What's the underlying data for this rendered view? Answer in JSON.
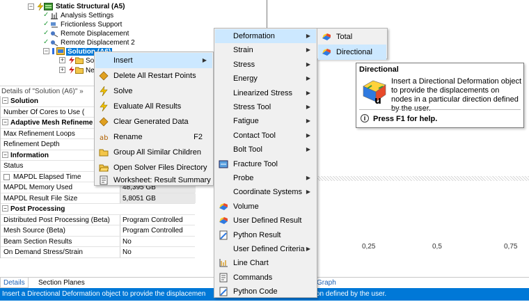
{
  "tree": {
    "items": [
      {
        "label": "Static Structural (A5)",
        "bold": true
      },
      {
        "label": "Analysis Settings"
      },
      {
        "label": "Frictionless Support"
      },
      {
        "label": "Remote Displacement"
      },
      {
        "label": "Remote Displacement 2"
      },
      {
        "label": "Solution (A6)",
        "selected": true
      },
      {
        "label": "So"
      },
      {
        "label": "Ne"
      }
    ]
  },
  "details": {
    "header": "Details of \"Solution (A6)\" »",
    "rows": [
      {
        "kind": "group",
        "label": "Solution"
      },
      {
        "label": "Number Of Cores to Use (",
        "value": ""
      },
      {
        "kind": "group",
        "label": "Adaptive Mesh Refineme"
      },
      {
        "label": "Max Refinement Loops",
        "value": ""
      },
      {
        "label": "Refinement Depth",
        "value": ""
      },
      {
        "kind": "group",
        "label": "Information"
      },
      {
        "label": "Status",
        "value": ""
      },
      {
        "label": "MAPDL Elapsed Time",
        "value": "",
        "checkbox": true
      },
      {
        "label": "MAPDL Memory Used",
        "value": "48,395 GB",
        "grey": true
      },
      {
        "label": "MAPDL Result File Size",
        "value": "5,8051 GB",
        "grey": true
      },
      {
        "kind": "group",
        "label": "Post Processing"
      },
      {
        "label": "Distributed Post Processing (Beta)",
        "value": "Program Controlled"
      },
      {
        "label": "Mesh Source (Beta)",
        "value": "Program Controlled"
      },
      {
        "label": "Beam Section Results",
        "value": "No"
      },
      {
        "label": "On Demand Stress/Strain",
        "value": "No"
      }
    ]
  },
  "graph_axis": [
    "0,25",
    "0,5",
    "0,75"
  ],
  "bottom_tabs": [
    "Details",
    "Section Planes",
    "Graph"
  ],
  "status_text": "Insert a Directional Deformation object to provide the displacemen",
  "status_text_tail": "on defined by the user.",
  "menu1": {
    "items": [
      {
        "label": "Insert",
        "submenu": true,
        "highlight": true,
        "icon": ""
      },
      {
        "label": "Delete All Restart Points",
        "icon": "delete-restart-icon"
      },
      {
        "label": "Solve",
        "icon": "lightning-icon"
      },
      {
        "label": "Evaluate All Results",
        "icon": "lightning-icon"
      },
      {
        "label": "Clear Generated Data",
        "icon": "clear-data-icon"
      },
      {
        "label": "Rename",
        "shortcut": "F2",
        "icon": "rename-icon"
      },
      {
        "label": "Group All Similar Children",
        "icon": "folder-icon"
      },
      {
        "label": "Open Solver Files Directory",
        "icon": "folder-open-icon"
      },
      {
        "label": "Worksheet: Result Summary",
        "icon": "worksheet-icon"
      }
    ]
  },
  "menu2": {
    "items": [
      {
        "label": "Deformation",
        "submenu": true,
        "highlight": true
      },
      {
        "label": "Strain",
        "submenu": true
      },
      {
        "label": "Stress",
        "submenu": true
      },
      {
        "label": "Energy",
        "submenu": true
      },
      {
        "label": "Linearized Stress",
        "submenu": true
      },
      {
        "label": "Stress Tool",
        "submenu": true
      },
      {
        "label": "Fatigue",
        "submenu": true
      },
      {
        "label": "Contact Tool",
        "submenu": true
      },
      {
        "label": "Bolt Tool",
        "submenu": true
      },
      {
        "label": "Fracture Tool",
        "icon": "fracture-tool-icon"
      },
      {
        "label": "Probe",
        "submenu": true
      },
      {
        "label": "Coordinate Systems",
        "submenu": true
      },
      {
        "label": "Volume",
        "icon": "volume-icon"
      },
      {
        "label": "User Defined Result",
        "icon": "user-defined-result-icon"
      },
      {
        "label": "Python Result",
        "icon": "python-result-icon"
      },
      {
        "label": "User Defined Criteria",
        "submenu": true
      },
      {
        "label": "Line Chart",
        "icon": "line-chart-icon"
      },
      {
        "label": "Commands",
        "icon": "commands-icon"
      },
      {
        "label": "Python Code",
        "icon": "python-code-icon"
      }
    ]
  },
  "menu3": {
    "items": [
      {
        "label": "Total",
        "icon": "total-deformation-icon"
      },
      {
        "label": "Directional",
        "highlight": true,
        "icon": "directional-deformation-icon"
      }
    ]
  },
  "tooltip": {
    "title": "Directional",
    "body": "Insert a Directional Deformation object to provide the displacements on nodes in a particular direction defined by the user.",
    "help": "Press F1 for help."
  },
  "colors": {
    "accent": "#0078d7",
    "menu_highlight": "#cce8ff",
    "status_bar": "#0078d7"
  }
}
